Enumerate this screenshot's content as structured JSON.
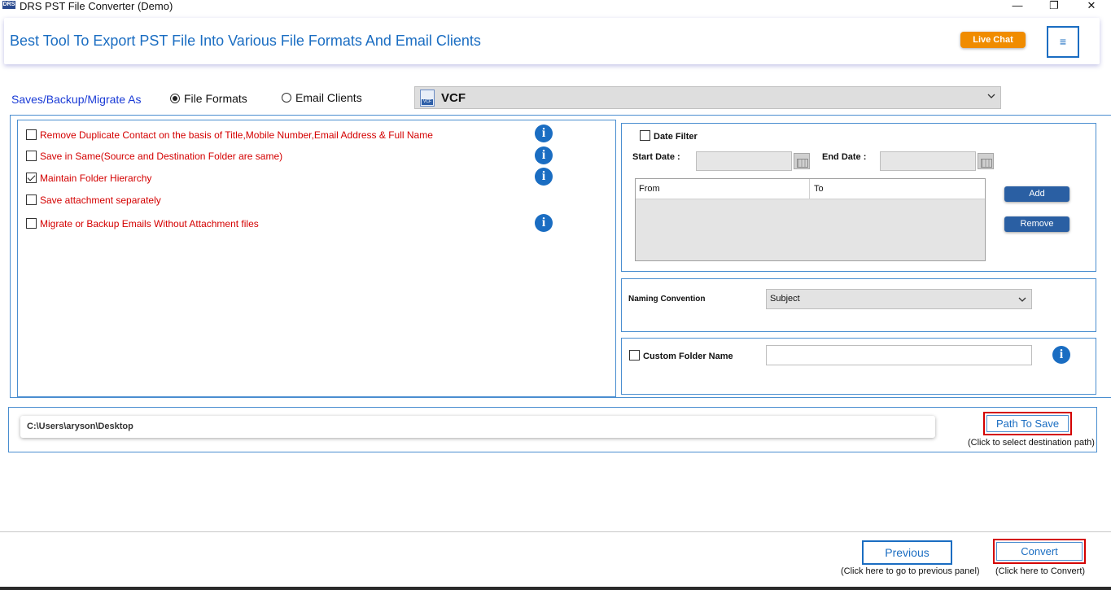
{
  "window": {
    "logo_text": "DRS",
    "title": "DRS PST File Converter (Demo)",
    "min_glyph": "—",
    "max_glyph": "❐",
    "close_glyph": "✕"
  },
  "header": {
    "title": "Best Tool To Export PST File Into Various File Formats And Email Clients",
    "live_chat_label": "Live Chat",
    "menu_glyph": "≡"
  },
  "save_as": {
    "label": "Saves/Backup/Migrate As",
    "option_file_formats": "File Formats",
    "option_email_clients": "Email Clients",
    "selected": "File Formats",
    "format_icon_text": "VCF",
    "format_value": "VCF"
  },
  "options": [
    {
      "label": "Remove Duplicate Contact on the basis of Title,Mobile Number,Email Address & Full Name",
      "checked": false,
      "info": true
    },
    {
      "label": "Save in Same(Source and Destination Folder are same)",
      "checked": false,
      "info": true
    },
    {
      "label": "Maintain Folder Hierarchy",
      "checked": true,
      "info": true
    },
    {
      "label": "Save attachment separately",
      "checked": false,
      "info": false
    },
    {
      "label": "Migrate or Backup Emails Without Attachment files",
      "checked": false,
      "info": true
    }
  ],
  "info_glyph": "i",
  "date_filter": {
    "label": "Date Filter",
    "checked": false,
    "start_label": "Start Date :",
    "end_label": "End Date :",
    "start_value": "",
    "end_value": "",
    "col_from": "From",
    "col_to": "To",
    "add_label": "Add",
    "remove_label": "Remove"
  },
  "naming": {
    "label": "Naming Convention",
    "value": "Subject"
  },
  "custom_folder": {
    "label": "Custom Folder Name",
    "checked": false,
    "value": ""
  },
  "path": {
    "value": "C:\\Users\\aryson\\Desktop",
    "button_label": "Path To Save",
    "hint": "(Click to select destination path)"
  },
  "footer": {
    "previous_label": "Previous",
    "previous_hint": "(Click here to go to previous panel)",
    "convert_label": "Convert",
    "convert_hint": "(Click here to Convert)"
  },
  "colors": {
    "accent_blue": "#1a6dc2",
    "option_red": "#d40000",
    "live_chat_orange": "#f08c00",
    "button_blue": "#2a5fa3"
  }
}
